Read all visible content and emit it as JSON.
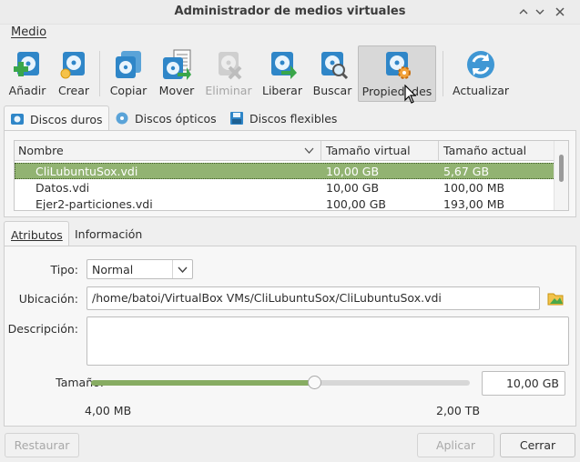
{
  "window": {
    "title": "Administrador de medios virtuales"
  },
  "menu": {
    "items": [
      "Medio"
    ]
  },
  "toolbar": {
    "buttons": [
      {
        "label": "Añadir",
        "icon": "add-disk-icon",
        "enabled": true
      },
      {
        "label": "Crear",
        "icon": "create-disk-icon",
        "enabled": true
      },
      {
        "label": "Copiar",
        "icon": "copy-disk-icon",
        "enabled": true
      },
      {
        "label": "Mover",
        "icon": "move-disk-icon",
        "enabled": true
      },
      {
        "label": "Eliminar",
        "icon": "remove-disk-icon",
        "enabled": false
      },
      {
        "label": "Liberar",
        "icon": "release-disk-icon",
        "enabled": true
      },
      {
        "label": "Buscar",
        "icon": "search-disk-icon",
        "enabled": true
      },
      {
        "label": "Propiedades",
        "icon": "properties-disk-icon",
        "enabled": true,
        "active": true
      },
      {
        "label": "Actualizar",
        "icon": "refresh-icon",
        "enabled": true
      }
    ]
  },
  "media_tabs": [
    {
      "label": "Discos duros",
      "icon": "hard-disk-icon",
      "selected": true
    },
    {
      "label": "Discos ópticos",
      "icon": "optical-disk-icon",
      "selected": false
    },
    {
      "label": "Discos flexibles",
      "icon": "floppy-disk-icon",
      "selected": false
    }
  ],
  "disk_table": {
    "columns": [
      "Nombre",
      "Tamaño virtual",
      "Tamaño actual"
    ],
    "rows": [
      {
        "name": "CliLubuntuSox.vdi",
        "virtual": "10,00 GB",
        "actual": "5,67 GB",
        "selected": true
      },
      {
        "name": "Datos.vdi",
        "virtual": "10,00 GB",
        "actual": "100,00 MB",
        "selected": false
      },
      {
        "name": "Ejer2-particiones.vdi",
        "virtual": "100,00 GB",
        "actual": "193,00 MB",
        "selected": false
      }
    ]
  },
  "detail_tabs": [
    {
      "label": "Atributos",
      "selected": true
    },
    {
      "label": "Información",
      "selected": false
    }
  ],
  "attributes": {
    "type_label": "Tipo:",
    "type_value": "Normal",
    "location_label": "Ubicación:",
    "location_value": "/home/batoi/VirtualBox VMs/CliLubuntuSox/CliLubuntuSox.vdi",
    "description_label": "Descripción:",
    "description_value": "",
    "size_label": "Tamaño:",
    "size_value": "10,00 GB",
    "size_min": "4,00 MB",
    "size_max": "2,00 TB",
    "size_slider_fraction": 0.59
  },
  "buttons": {
    "reset": "Restaurar",
    "apply": "Aplicar",
    "close": "Cerrar"
  },
  "colors": {
    "selection": "#92b372",
    "slider_fill": "#87ac62",
    "icon_blue": "#2f86c8",
    "icon_green": "#3aa64a"
  }
}
